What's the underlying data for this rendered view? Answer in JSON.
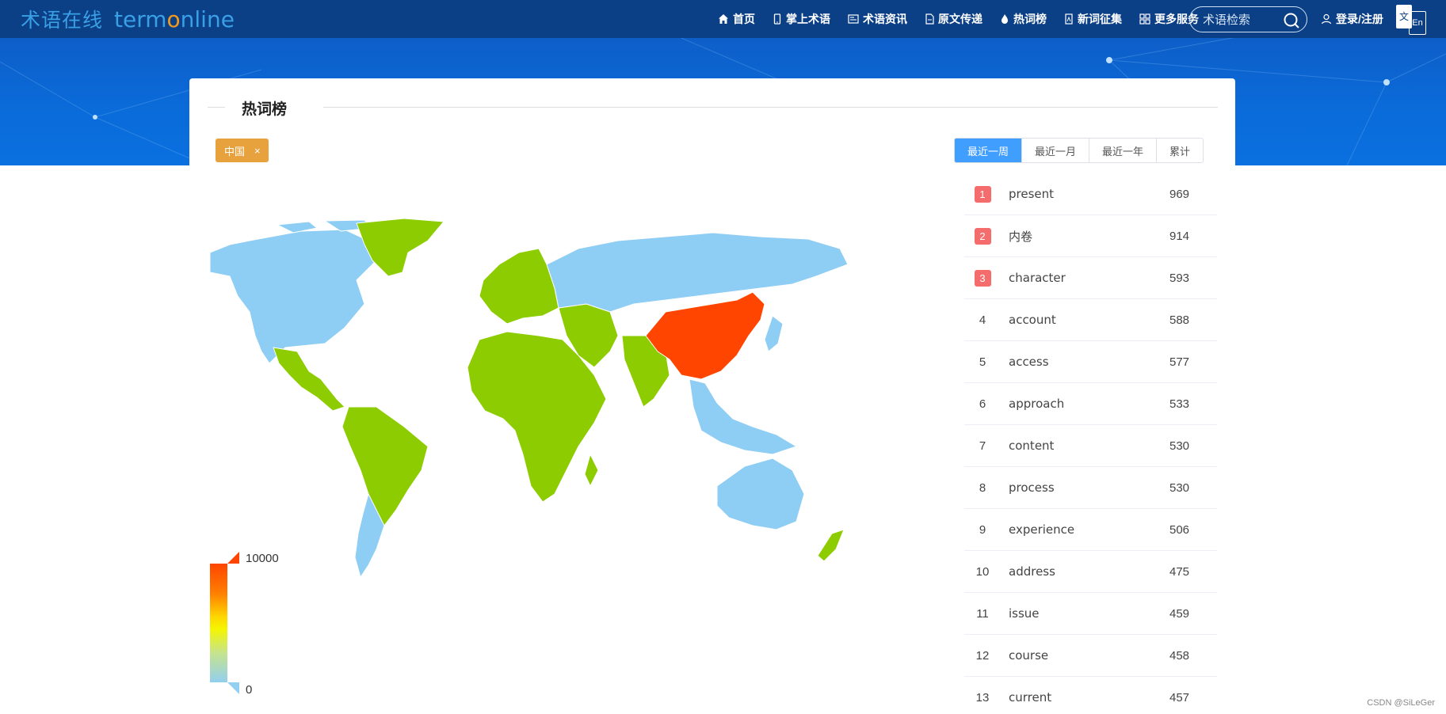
{
  "header": {
    "logo_cn": "术语在线",
    "logo_en_prefix": "term",
    "logo_en_o": "o",
    "logo_en_suffix": "nline",
    "nav": [
      {
        "label": "首页",
        "icon": "home-icon"
      },
      {
        "label": "掌上术语",
        "icon": "phone-icon"
      },
      {
        "label": "术语资讯",
        "icon": "news-icon"
      },
      {
        "label": "原文传递",
        "icon": "document-icon"
      },
      {
        "label": "热词榜",
        "icon": "flame-icon"
      },
      {
        "label": "新词征集",
        "icon": "collection-icon"
      },
      {
        "label": "更多服务",
        "icon": "grid-icon"
      }
    ],
    "search_placeholder": "术语检索",
    "login_label": "登录/注册",
    "lang_zh": "文",
    "lang_en": "En"
  },
  "section": {
    "title": "热词榜",
    "region_tag": "中国",
    "region_tag_close": "×"
  },
  "periods": [
    {
      "label": "最近一周",
      "active": true
    },
    {
      "label": "最近一月",
      "active": false
    },
    {
      "label": "最近一年",
      "active": false
    },
    {
      "label": "累计",
      "active": false
    }
  ],
  "map": {
    "legend_max": "10000",
    "legend_min": "0",
    "colors": {
      "highlight": "#ff4500",
      "mid": "#8ccc00",
      "low": "#8ecdf4",
      "border": "#ffffff"
    },
    "regions": {
      "china": "highlight",
      "north_america": "low",
      "russia": "low",
      "australia": "low",
      "argentina": "low",
      "southeast_asia": "low",
      "greenland": "mid",
      "mexico_central_america": "mid",
      "south_america": "mid",
      "europe": "mid",
      "africa": "mid",
      "middle_east": "mid",
      "south_asia": "mid",
      "japan": "low",
      "new_zealand": "mid"
    }
  },
  "ranking": [
    {
      "rank": "1",
      "word": "present",
      "count": "969"
    },
    {
      "rank": "2",
      "word": "内卷",
      "count": "914"
    },
    {
      "rank": "3",
      "word": "character",
      "count": "593"
    },
    {
      "rank": "4",
      "word": "account",
      "count": "588"
    },
    {
      "rank": "5",
      "word": "access",
      "count": "577"
    },
    {
      "rank": "6",
      "word": "approach",
      "count": "533"
    },
    {
      "rank": "7",
      "word": "content",
      "count": "530"
    },
    {
      "rank": "8",
      "word": "process",
      "count": "530"
    },
    {
      "rank": "9",
      "word": "experience",
      "count": "506"
    },
    {
      "rank": "10",
      "word": "address",
      "count": "475"
    },
    {
      "rank": "11",
      "word": "issue",
      "count": "459"
    },
    {
      "rank": "12",
      "word": "course",
      "count": "458"
    },
    {
      "rank": "13",
      "word": "current",
      "count": "457"
    }
  ],
  "watermark": "CSDN @SiLeGer"
}
